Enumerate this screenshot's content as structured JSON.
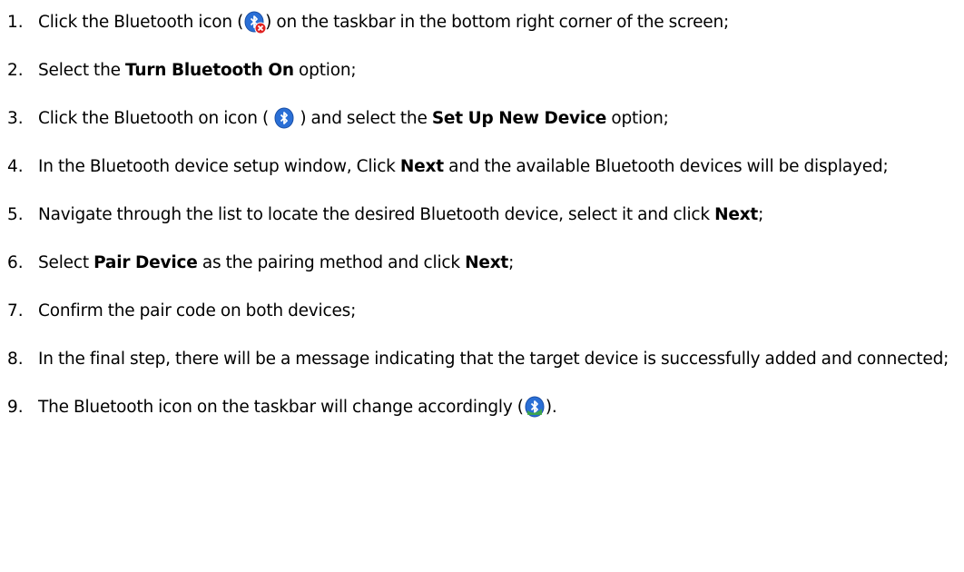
{
  "steps": [
    {
      "number": "1.",
      "parts": {
        "a": "Click the Bluetooth icon (",
        "b": ") on the taskbar in the bottom right corner of the screen;"
      },
      "icon": "bluetooth-off-icon"
    },
    {
      "number": "2.",
      "parts": {
        "a": "Select the ",
        "bold": "Turn Bluetooth On",
        "b": " option;"
      }
    },
    {
      "number": "3.",
      "parts": {
        "a": " Click the Bluetooth on icon ( ",
        "b": " ) and select the ",
        "bold": "Set Up New Device",
        "c": " option;"
      },
      "icon": "bluetooth-on-icon"
    },
    {
      "number": "4.",
      "parts": {
        "a": "In the Bluetooth device setup window, Click ",
        "bold": "Next",
        "b": " and the available Bluetooth devices will be displayed;"
      }
    },
    {
      "number": "5.",
      "parts": {
        "a": "Navigate through the list to locate the desired Bluetooth device, select it and click ",
        "bold": "Next",
        "b": ";"
      }
    },
    {
      "number": "6.",
      "parts": {
        "a": "Select ",
        "bold": "Pair Device",
        "b": " as the pairing method and click ",
        "bold2": "Next",
        "c": ";"
      }
    },
    {
      "number": "7.",
      "parts": {
        "a": "Confirm the pair code on both devices;"
      }
    },
    {
      "number": "8.",
      "parts": {
        "a": "In the final step, there will be a message indicating that the target device is successfully added and connected;"
      }
    },
    {
      "number": "9.",
      "parts": {
        "a": "The Bluetooth icon on the taskbar will change accordingly (",
        "b": ")."
      },
      "icon": "bluetooth-connected-icon"
    }
  ],
  "colors": {
    "bluetooth_blue": "#1f5fbf",
    "bluetooth_connected_green": "#3fae3a",
    "error_red": "#e02020"
  }
}
